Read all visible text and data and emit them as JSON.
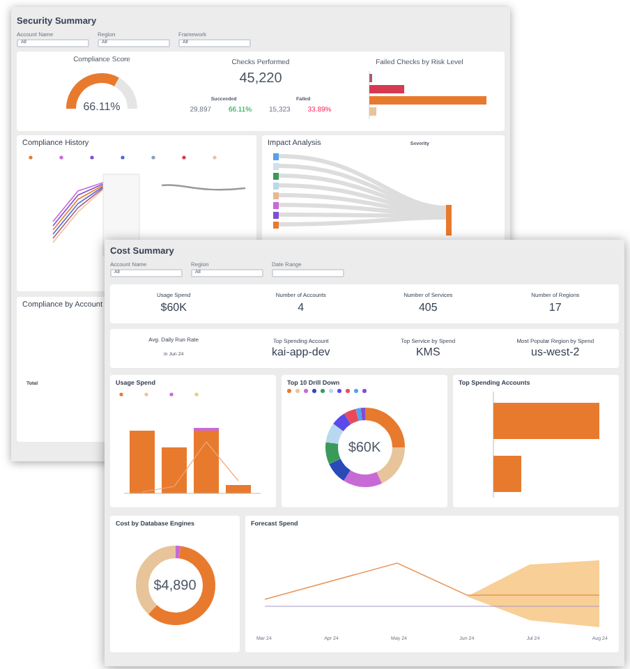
{
  "security": {
    "title": "Security Summary",
    "filters": [
      {
        "label": "Account Name",
        "value": "All"
      },
      {
        "label": "Region",
        "value": "All"
      },
      {
        "label": "Framework",
        "value": "All"
      }
    ],
    "compliance_score": {
      "title": "Compliance Score",
      "value": "66.11%"
    },
    "checks": {
      "title": "Checks Performed",
      "total": "45,220",
      "succeeded_label": "Succeeded",
      "failed_label": "Failed",
      "succeeded": "29,897",
      "succeeded_pct": "66.11%",
      "failed": "15,323",
      "failed_pct": "33.89%"
    },
    "risk": {
      "title": "Failed Checks by Risk Level"
    },
    "history": {
      "title": "Compliance History"
    },
    "impact": {
      "title": "Impact Analysis",
      "filter_label": "Severity"
    },
    "by_account": {
      "title": "Compliance by Account",
      "total_label": "Total"
    }
  },
  "cost": {
    "title": "Cost Summary",
    "filters": [
      {
        "label": "Account Name",
        "value": "All"
      },
      {
        "label": "Region",
        "value": "All"
      },
      {
        "label": "Date Range"
      }
    ],
    "kpis": [
      {
        "label": "Usage Spend",
        "value": "$60K"
      },
      {
        "label": "Number of Accounts",
        "value": "4"
      },
      {
        "label": "Number of Services",
        "value": "405"
      },
      {
        "label": "Number of Regions",
        "value": "17"
      }
    ],
    "highlights": [
      {
        "label": "Avg. Daily Run Rate",
        "note": "in Jun 24"
      },
      {
        "label": "Top Spending Account",
        "value": "kai-app-dev"
      },
      {
        "label": "Top Service by Spend",
        "value": "KMS"
      },
      {
        "label": "Most Popular Region by Spend",
        "value": "us-west-2"
      }
    ],
    "usage": {
      "title": "Usage Spend"
    },
    "drill": {
      "title": "Top 10 Drill Down",
      "center": "$60K"
    },
    "accounts": {
      "title": "Top Spending Accounts"
    },
    "engines": {
      "title": "Cost by Database Engines",
      "center": "$4,890"
    },
    "forecast": {
      "title": "Forecast Spend",
      "x_labels": [
        "Mar 24",
        "Apr 24",
        "May 24",
        "Jun 24",
        "Jul 24",
        "Aug 24"
      ]
    }
  }
}
